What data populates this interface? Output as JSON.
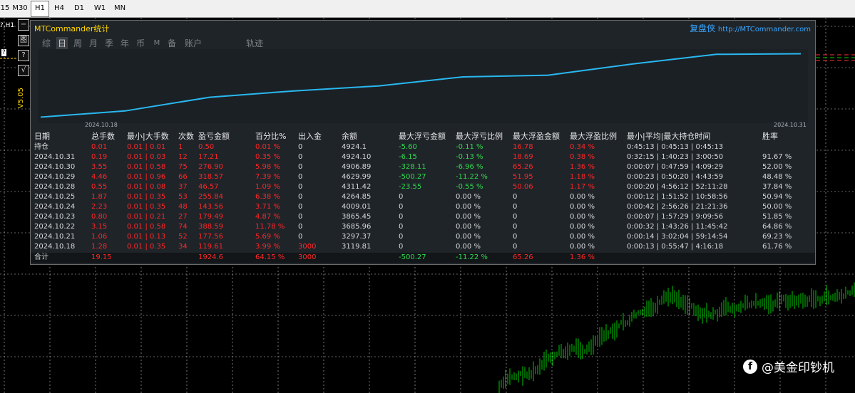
{
  "timeframes": [
    "15",
    "M30",
    "H1",
    "H4",
    "D1",
    "W1",
    "MN"
  ],
  "active_timeframe": "H1",
  "chart": {
    "symbol_label": "?,H1",
    "bid_label": "?",
    "version_label": "V5.05",
    "side_buttons": [
      "−",
      "图",
      "?",
      "√"
    ]
  },
  "panel": {
    "title": "MTCommander统计",
    "link_text": "复盘侠",
    "link_url": "http://MTCommander.com",
    "tabs": [
      "综",
      "日",
      "周",
      "月",
      "季",
      "年",
      "币",
      "M",
      "备",
      "账户",
      "轨迹"
    ],
    "active_tab": "日",
    "equity_curve": {
      "start_label": "2024.10.18",
      "end_label": "2024.10.31",
      "dates": [
        "2024.10.18",
        "2024.10.21",
        "2024.10.22",
        "2024.10.23",
        "2024.10.24",
        "2024.10.25",
        "2024.10.28",
        "2024.10.29",
        "2024.10.30",
        "2024.10.31"
      ],
      "balance": [
        3119.81,
        3297.37,
        3685.96,
        3865.45,
        4009.01,
        4264.85,
        4311.42,
        4629.99,
        4906.89,
        4924.1
      ],
      "line_color": "#29b8f0"
    },
    "headers": [
      "日期",
      "总手数",
      "最小|大手数",
      "次数",
      "盈亏金额",
      "百分比%",
      "出入金",
      "余额",
      "最大浮亏金额",
      "最大浮亏比例",
      "最大浮盈金额",
      "最大浮盈比例",
      "最小|平均|最大持仓时间",
      "胜率"
    ],
    "rows": [
      [
        "持仓",
        "0.01",
        "0.01 | 0.01",
        "1",
        "0.50",
        "0.01 %",
        "0",
        "4924.1",
        "-5.60",
        "-0.11 %",
        "16.78",
        "0.34 %",
        "0:45:13 | 0:45:13 | 0:45:13",
        ""
      ],
      [
        "2024.10.31",
        "0.19",
        "0.01 | 0.03",
        "12",
        "17.21",
        "0.35 %",
        "0",
        "4924.10",
        "-6.15",
        "-0.13 %",
        "18.69",
        "0.38 %",
        "0:32:15 | 1:40:23 | 3:00:50",
        "91.67 %"
      ],
      [
        "2024.10.30",
        "3.55",
        "0.01 | 0.58",
        "75",
        "276.90",
        "5.98 %",
        "0",
        "4906.89",
        "-328.11",
        "-6.96 %",
        "65.26",
        "1.36 %",
        "0:00:07 | 0:47:59 | 4:09:29",
        "52.00 %"
      ],
      [
        "2024.10.29",
        "4.46",
        "0.01 | 0.96",
        "66",
        "318.57",
        "7.39 %",
        "0",
        "4629.99",
        "-500.27",
        "-11.22 %",
        "51.95",
        "1.18 %",
        "0:00:23 | 0:50:20 | 4:43:59",
        "48.48 %"
      ],
      [
        "2024.10.28",
        "0.55",
        "0.01 | 0.08",
        "37",
        "46.57",
        "1.09 %",
        "0",
        "4311.42",
        "-23.55",
        "-0.55 %",
        "50.06",
        "1.17 %",
        "0:00:20 | 4:56:12 | 52:11:28",
        "37.84 %"
      ],
      [
        "2024.10.25",
        "1.87",
        "0.01 | 0.35",
        "53",
        "255.84",
        "6.38 %",
        "0",
        "4264.85",
        "0",
        "0.00 %",
        "0",
        "0.00 %",
        "0:00:12 | 1:51:52 | 10:58:56",
        "50.94 %"
      ],
      [
        "2024.10.24",
        "2.23",
        "0.01 | 0.35",
        "48",
        "143.56",
        "3.71 %",
        "0",
        "4009.01",
        "0",
        "0.00 %",
        "0",
        "0.00 %",
        "0:00:42 | 2:56:26 | 21:21:36",
        "50.00 %"
      ],
      [
        "2024.10.23",
        "0.80",
        "0.01 | 0.21",
        "27",
        "179.49",
        "4.87 %",
        "0",
        "3865.45",
        "0",
        "0.00 %",
        "0",
        "0.00 %",
        "0:00:07 | 1:57:29 | 9:09:56",
        "51.85 %"
      ],
      [
        "2024.10.22",
        "3.15",
        "0.01 | 0.58",
        "74",
        "388.59",
        "11.78 %",
        "0",
        "3685.96",
        "0",
        "0.00 %",
        "0",
        "0.00 %",
        "0:00:32 | 1:43:26 | 11:45:42",
        "64.86 %"
      ],
      [
        "2024.10.21",
        "1.06",
        "0.01 | 0.13",
        "52",
        "177.56",
        "5.69 %",
        "0",
        "3297.37",
        "0",
        "0.00 %",
        "0",
        "0.00 %",
        "0:00:14 | 3:02:04 | 59:14:54",
        "69.23 %"
      ],
      [
        "2024.10.18",
        "1.28",
        "0.01 | 0.35",
        "34",
        "119.61",
        "3.99 %",
        "3000",
        "3119.81",
        "0",
        "0.00 %",
        "0",
        "0.00 %",
        "0:00:13 | 0:55:47 | 4:16:18",
        "61.76 %"
      ]
    ],
    "total": [
      "合计",
      "19.15",
      "",
      "",
      "1924.6",
      "64.15 %",
      "3000",
      "",
      "-500.27",
      "-11.22 %",
      "65.26",
      "1.36 %",
      "",
      ""
    ]
  },
  "watermark": {
    "icon": "f",
    "text": "@美金印钞机"
  },
  "colors": {
    "positive": "#ff2626",
    "negative": "#2fdc4e",
    "candle": "#00c800",
    "grid": "#c8c8c8"
  }
}
